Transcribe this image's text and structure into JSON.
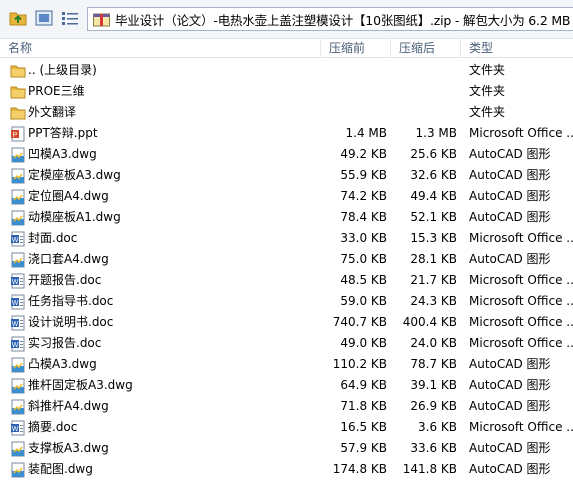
{
  "path": "毕业设计（论文）-电热水壶上盖注塑模设计【10张图纸】.zip - 解包大小为 6.2 MB",
  "toolbar": {
    "buttons": [
      {
        "name": "up-folder-button",
        "icon": "up-folder-icon"
      },
      {
        "name": "large-icons-view-button",
        "icon": "thumbnail-view-icon"
      },
      {
        "name": "details-view-button",
        "icon": "details-view-icon"
      }
    ]
  },
  "columns": {
    "name": "名称",
    "size": "压缩前",
    "compressed": "压缩后",
    "type": "类型"
  },
  "colors": {
    "folder": "#e8b63c",
    "dwg": "#3c8fcf",
    "doc": "#2e63b3",
    "ppt": "#d24a2a",
    "header_text": "#4c607a"
  },
  "files": [
    {
      "icon": "folder-up-icon",
      "name": ".. (上级目录)",
      "size": "",
      "compressed": "",
      "type": "文件夹"
    },
    {
      "icon": "folder-icon",
      "name": "PROE三维",
      "size": "",
      "compressed": "",
      "type": "文件夹"
    },
    {
      "icon": "folder-icon",
      "name": "外文翻译",
      "size": "",
      "compressed": "",
      "type": "文件夹"
    },
    {
      "icon": "ppt-icon",
      "name": "PPT答辩.ppt",
      "size": "1.4 MB",
      "compressed": "1.3 MB",
      "type": "Microsoft Office ..."
    },
    {
      "icon": "dwg-icon",
      "name": "凹模A3.dwg",
      "size": "49.2 KB",
      "compressed": "25.6 KB",
      "type": "AutoCAD 图形"
    },
    {
      "icon": "dwg-icon",
      "name": "定模座板A3.dwg",
      "size": "55.9 KB",
      "compressed": "32.6 KB",
      "type": "AutoCAD 图形"
    },
    {
      "icon": "dwg-icon",
      "name": "定位圈A4.dwg",
      "size": "74.2 KB",
      "compressed": "49.4 KB",
      "type": "AutoCAD 图形"
    },
    {
      "icon": "dwg-icon",
      "name": "动模座板A1.dwg",
      "size": "78.4 KB",
      "compressed": "52.1 KB",
      "type": "AutoCAD 图形"
    },
    {
      "icon": "doc-icon",
      "name": "封面.doc",
      "size": "33.0 KB",
      "compressed": "15.3 KB",
      "type": "Microsoft Office ..."
    },
    {
      "icon": "dwg-icon",
      "name": "浇口套A4.dwg",
      "size": "75.0 KB",
      "compressed": "28.1 KB",
      "type": "AutoCAD 图形"
    },
    {
      "icon": "doc-icon",
      "name": "开题报告.doc",
      "size": "48.5 KB",
      "compressed": "21.7 KB",
      "type": "Microsoft Office ..."
    },
    {
      "icon": "doc-icon",
      "name": "任务指导书.doc",
      "size": "59.0 KB",
      "compressed": "24.3 KB",
      "type": "Microsoft Office ..."
    },
    {
      "icon": "doc-icon",
      "name": "设计说明书.doc",
      "size": "740.7 KB",
      "compressed": "400.4 KB",
      "type": "Microsoft Office ..."
    },
    {
      "icon": "doc-icon",
      "name": "实习报告.doc",
      "size": "49.0 KB",
      "compressed": "24.0 KB",
      "type": "Microsoft Office ..."
    },
    {
      "icon": "dwg-icon",
      "name": "凸模A3.dwg",
      "size": "110.2 KB",
      "compressed": "78.7 KB",
      "type": "AutoCAD 图形"
    },
    {
      "icon": "dwg-icon",
      "name": "推杆固定板A3.dwg",
      "size": "64.9 KB",
      "compressed": "39.1 KB",
      "type": "AutoCAD 图形"
    },
    {
      "icon": "dwg-icon",
      "name": "斜推杆A4.dwg",
      "size": "71.8 KB",
      "compressed": "26.9 KB",
      "type": "AutoCAD 图形"
    },
    {
      "icon": "doc-icon",
      "name": "摘要.doc",
      "size": "16.5 KB",
      "compressed": "3.6 KB",
      "type": "Microsoft Office ..."
    },
    {
      "icon": "dwg-icon",
      "name": "支撑板A3.dwg",
      "size": "57.9 KB",
      "compressed": "33.6 KB",
      "type": "AutoCAD 图形"
    },
    {
      "icon": "dwg-icon",
      "name": "装配图.dwg",
      "size": "174.8 KB",
      "compressed": "141.8 KB",
      "type": "AutoCAD 图形"
    }
  ]
}
